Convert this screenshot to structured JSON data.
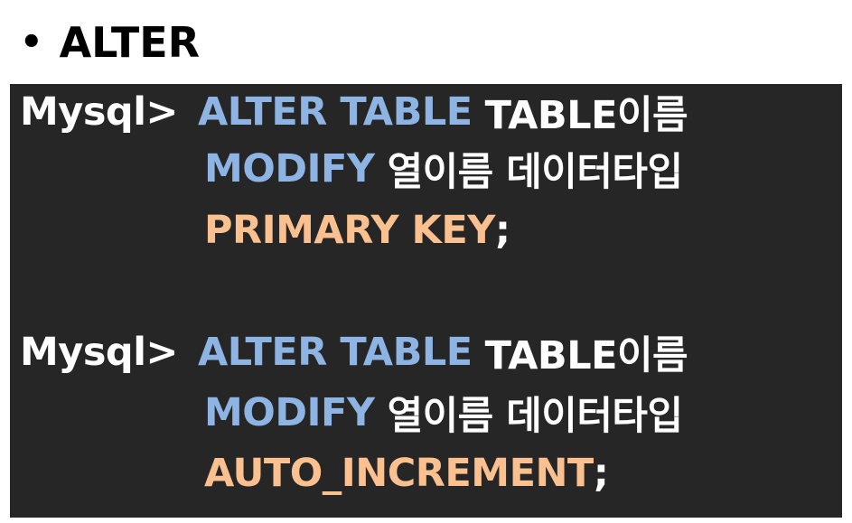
{
  "heading": {
    "bullet": "•",
    "title": "ALTER"
  },
  "colors": {
    "background": "#262626",
    "keyword_blue": "#8eb4e3",
    "keyword_orange": "#fac090",
    "text_white": "#ffffff"
  },
  "blocks": [
    {
      "line1": {
        "prompt": "Mysql>",
        "keyword": "ALTER TABLE",
        "arg": "TABLE이름"
      },
      "line2": {
        "keyword": "MODIFY",
        "arg": "열이름 데이터타입"
      },
      "line3": {
        "keyword": "PRIMARY KEY",
        "terminator": ";"
      }
    },
    {
      "line1": {
        "prompt": "Mysql>",
        "keyword": "ALTER TABLE",
        "arg": "TABLE이름"
      },
      "line2": {
        "keyword": "MODIFY",
        "arg": "열이름 데이터타입"
      },
      "line3": {
        "keyword": "AUTO_INCREMENT",
        "terminator": ";"
      }
    }
  ]
}
